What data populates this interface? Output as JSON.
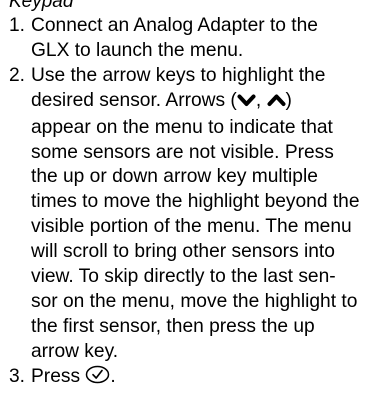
{
  "heading": "Keypad",
  "steps": [
    {
      "number": "1.",
      "lines": [
        "Connect an Analog Adapter to the",
        "GLX to launch the menu."
      ]
    },
    {
      "number": "2.",
      "line1": "Use the arrow keys to highlight the",
      "line2_before": "desired sensor. Arrows (",
      "line2_sep": ", ",
      "line2_after": ")",
      "lines_rest": [
        "appear on the menu to indicate that",
        "some sensors are not visible. Press",
        "the up or down arrow key multiple",
        "times to move the highlight beyond the",
        "visible portion of the menu. The menu",
        "will scroll to bring other sensors into",
        "view. To skip directly to the last sen-",
        "sor on the menu, move the highlight to",
        "the first sensor, then press the up",
        "arrow key."
      ],
      "icons": [
        "chevron-down-icon",
        "chevron-up-icon"
      ]
    },
    {
      "number": "3.",
      "text": "Press",
      "icon": "check-circle-icon",
      "end": "."
    }
  ]
}
